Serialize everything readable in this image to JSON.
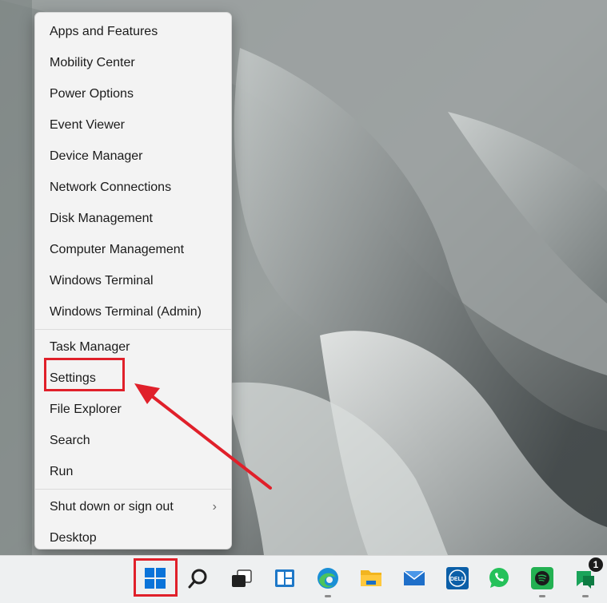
{
  "menu": {
    "groups": [
      [
        "Apps and Features",
        "Mobility Center",
        "Power Options",
        "Event Viewer",
        "Device Manager",
        "Network Connections",
        "Disk Management",
        "Computer Management",
        "Windows Terminal",
        "Windows Terminal (Admin)"
      ],
      [
        "Task Manager",
        "Settings",
        "File Explorer",
        "Search",
        "Run"
      ],
      [
        "Shut down or sign out",
        "Desktop"
      ]
    ],
    "highlighted_item": "Settings",
    "submenu_item": "Shut down or sign out",
    "chevron_glyph": "›"
  },
  "taskbar": {
    "icons": [
      "start-icon",
      "search-icon",
      "task-view-icon",
      "widgets-icon",
      "edge-icon",
      "file-explorer-icon",
      "mail-icon",
      "dell-icon",
      "whatsapp-icon",
      "spotify-icon",
      "chat-icon"
    ],
    "chat_badge": "1",
    "dell_label": "DELL"
  },
  "colors": {
    "highlight": "#e0202a",
    "menu_bg": "#f3f3f3",
    "taskbar_bg": "#eef0f1",
    "start_blue": "#0a73d9"
  }
}
